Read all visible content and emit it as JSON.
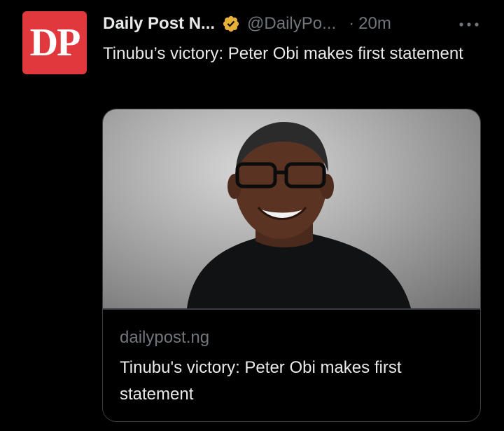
{
  "tweet": {
    "avatar_text": "DP",
    "display_name": "Daily Post N...",
    "handle": "@DailyPo...",
    "separator": "·",
    "time": "20m",
    "text": "Tinubu’s victory: Peter Obi makes first statement"
  },
  "card": {
    "domain": "dailypost.ng",
    "title": "Tinubu's victory: Peter Obi makes first statement"
  },
  "colors": {
    "background": "#000000",
    "text_primary": "#e7e9ea",
    "text_secondary": "#71767b",
    "avatar_bg": "#e0383c",
    "verified_gold": "#e8b23a",
    "card_border": "#3a3d42"
  },
  "icons": {
    "verified": "verified-badge-icon",
    "more": "more-options-icon"
  }
}
